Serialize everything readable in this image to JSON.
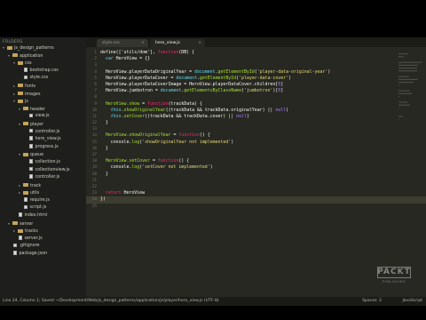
{
  "sidebar": {
    "header": "FOLDERS",
    "items": [
      {
        "label": "js_design_patterns",
        "type": "folder",
        "depth": 0,
        "open": true
      },
      {
        "label": "application",
        "type": "folder",
        "depth": 1,
        "open": true
      },
      {
        "label": "css",
        "type": "folder",
        "depth": 2,
        "open": true
      },
      {
        "label": "bootstrap.css",
        "type": "file",
        "depth": 3
      },
      {
        "label": "style.css",
        "type": "file",
        "depth": 3
      },
      {
        "label": "fonts",
        "type": "folder",
        "depth": 2,
        "open": false
      },
      {
        "label": "images",
        "type": "folder",
        "depth": 2,
        "open": false
      },
      {
        "label": "js",
        "type": "folder",
        "depth": 2,
        "open": true
      },
      {
        "label": "header",
        "type": "folder",
        "depth": 3,
        "open": true
      },
      {
        "label": "view.js",
        "type": "file",
        "depth": 4
      },
      {
        "label": "player",
        "type": "folder",
        "depth": 3,
        "open": true
      },
      {
        "label": "controller.js",
        "type": "file",
        "depth": 4
      },
      {
        "label": "hero_view.js",
        "type": "file",
        "depth": 4
      },
      {
        "label": "progress.js",
        "type": "file",
        "depth": 4
      },
      {
        "label": "queue",
        "type": "folder",
        "depth": 3,
        "open": true
      },
      {
        "label": "collection.js",
        "type": "file",
        "depth": 4
      },
      {
        "label": "collectionview.js",
        "type": "file",
        "depth": 4
      },
      {
        "label": "controller.js",
        "type": "file",
        "depth": 4
      },
      {
        "label": "track",
        "type": "folder",
        "depth": 3,
        "open": false
      },
      {
        "label": "utils",
        "type": "folder",
        "depth": 3,
        "open": false
      },
      {
        "label": "require.js",
        "type": "file",
        "depth": 3
      },
      {
        "label": "script.js",
        "type": "file",
        "depth": 3
      },
      {
        "label": "index.html",
        "type": "file",
        "depth": 2
      },
      {
        "label": "server",
        "type": "folder",
        "depth": 1,
        "open": true
      },
      {
        "label": "tracks",
        "type": "folder",
        "depth": 2,
        "open": false
      },
      {
        "label": "server.js",
        "type": "file",
        "depth": 2
      },
      {
        "label": ".gitignore",
        "type": "file",
        "depth": 1
      },
      {
        "label": "package.json",
        "type": "file",
        "depth": 1
      }
    ]
  },
  "tabs": [
    {
      "label": "style.css",
      "active": false
    },
    {
      "label": "hero_view.js",
      "active": true
    }
  ],
  "tab_close_glyph": "×",
  "code_lines": [
    [
      [
        "n",
        "define(['utils/dom'], "
      ],
      [
        "kw",
        "function"
      ],
      [
        "n",
        "(DB) {"
      ]
    ],
    [
      [
        "n",
        "  "
      ],
      [
        "bl",
        "var"
      ],
      [
        "n",
        " HeroView = {}"
      ]
    ],
    [],
    [
      [
        "n",
        "  HeroView.playerDataOriginalYear = "
      ],
      [
        "cy",
        "document"
      ],
      [
        "n",
        "."
      ],
      [
        "fn",
        "getElementById"
      ],
      [
        "n",
        "("
      ],
      [
        "st",
        "'player-data-original-year'"
      ],
      [
        "n",
        ")"
      ]
    ],
    [
      [
        "n",
        "  HeroView.playerDataCover = "
      ],
      [
        "cy",
        "document"
      ],
      [
        "n",
        "."
      ],
      [
        "fn",
        "getElementById"
      ],
      [
        "n",
        "("
      ],
      [
        "st",
        "'player-data-cover'"
      ],
      [
        "n",
        ")"
      ]
    ],
    [
      [
        "n",
        "  HeroView.playerDataCoverImage = HeroView.playerDataCover.children["
      ],
      [
        "nu",
        "0"
      ],
      [
        "n",
        "]"
      ]
    ],
    [
      [
        "n",
        "  HeroView.jumbotron = "
      ],
      [
        "cy",
        "document"
      ],
      [
        "n",
        "."
      ],
      [
        "fn",
        "getElementsByClassName"
      ],
      [
        "n",
        "("
      ],
      [
        "st",
        "'jumbotron'"
      ],
      [
        "n",
        ")["
      ],
      [
        "nu",
        "0"
      ],
      [
        "n",
        "]"
      ]
    ],
    [],
    [
      [
        "n",
        "  "
      ],
      [
        "fn",
        "HeroView.show"
      ],
      [
        "n",
        " = "
      ],
      [
        "kw",
        "function"
      ],
      [
        "n",
        "(trackData) {"
      ]
    ],
    [
      [
        "n",
        "    "
      ],
      [
        "bl",
        "this"
      ],
      [
        "n",
        "."
      ],
      [
        "fn",
        "showOriginalYear"
      ],
      [
        "n",
        "((trackData && trackData.originalYear) || "
      ],
      [
        "nu",
        "null"
      ],
      [
        "n",
        ")"
      ]
    ],
    [
      [
        "n",
        "    "
      ],
      [
        "bl",
        "this"
      ],
      [
        "n",
        "."
      ],
      [
        "fn",
        "setCover"
      ],
      [
        "n",
        "((trackData && trackData.cover) || "
      ],
      [
        "nu",
        "null"
      ],
      [
        "n",
        ")"
      ]
    ],
    [
      [
        "n",
        "  }"
      ]
    ],
    [],
    [
      [
        "n",
        "  "
      ],
      [
        "fn",
        "HeroView.showOriginalYear"
      ],
      [
        "n",
        " = "
      ],
      [
        "kw",
        "function"
      ],
      [
        "n",
        "() {"
      ]
    ],
    [
      [
        "n",
        "    console."
      ],
      [
        "fn",
        "log"
      ],
      [
        "n",
        "("
      ],
      [
        "st",
        "'showOriginalYear not implemented'"
      ],
      [
        "n",
        ")"
      ]
    ],
    [
      [
        "n",
        "  }"
      ]
    ],
    [],
    [
      [
        "n",
        "  "
      ],
      [
        "fn",
        "HeroView.setCover"
      ],
      [
        "n",
        " = "
      ],
      [
        "kw",
        "function"
      ],
      [
        "n",
        "() {"
      ]
    ],
    [
      [
        "n",
        "    console."
      ],
      [
        "fn",
        "log"
      ],
      [
        "n",
        "("
      ],
      [
        "st",
        "'setCover not implemented'"
      ],
      [
        "n",
        ")"
      ]
    ],
    [
      [
        "n",
        "  }"
      ]
    ],
    [],
    [],
    [
      [
        "n",
        "  "
      ],
      [
        "kw",
        "return"
      ],
      [
        "n",
        " HeroView"
      ]
    ],
    [
      [
        "n",
        "})"
      ]
    ],
    []
  ],
  "highlight_line": 24,
  "status": {
    "left": "Line 24, Column 1; Saved ~/Development/Web/js_design_patterns/application/js/player/hero_view.js (UTF-8)",
    "spaces": "Spaces: 2",
    "syntax": "JavaScript"
  },
  "logo": {
    "word": "PACKT",
    "sub": "PUBLISHING"
  },
  "colors": {
    "keyword": "#f92672",
    "string": "#e6db74",
    "function": "#a6e22e",
    "builtin": "#66d9ef",
    "number": "#ae81ff",
    "background": "#272822"
  }
}
